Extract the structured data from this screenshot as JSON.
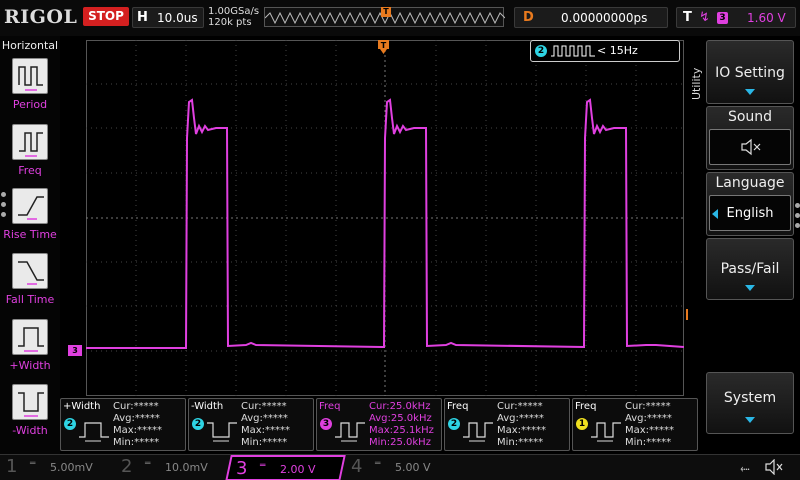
{
  "brand": "RIGOL",
  "run_state": "STOP",
  "horizontal": {
    "label": "H",
    "timebase": "10.0us",
    "sample_rate": "1.00GSa/s",
    "memory_depth": "120k pts"
  },
  "trigger_pos_marker": "T",
  "delay": {
    "label": "D",
    "value": "0.00000000ps"
  },
  "trigger": {
    "label": "T",
    "source_channel": "3",
    "level": "1.60 V"
  },
  "left_menu": {
    "title": "Horizontal",
    "items": [
      {
        "label": "Period",
        "icon": "period-icon"
      },
      {
        "label": "Freq",
        "icon": "frequency-icon"
      },
      {
        "label": "Rise Time",
        "icon": "rise-time-icon"
      },
      {
        "label": "Fall Time",
        "icon": "fall-time-icon"
      },
      {
        "label": "+Width",
        "icon": "positive-width-icon"
      },
      {
        "label": "-Width",
        "icon": "negative-width-icon"
      }
    ]
  },
  "grid": {
    "ch3_marker": "3",
    "trigger_level_marker": "T",
    "ch2_label": {
      "channel": "2",
      "text": "< 15Hz"
    }
  },
  "right_menu": {
    "side_tab": "Utility",
    "io_setting": "IO Setting",
    "sound": {
      "label": "Sound",
      "icon": "speaker-mute-icon"
    },
    "language": {
      "label": "Language",
      "value": "English"
    },
    "pass_fail": "Pass/Fail",
    "system": "System"
  },
  "measurements": [
    {
      "title": "+Width",
      "channel": "2",
      "cur": "Cur:*****",
      "avg": "Avg:*****",
      "max": "Max:*****",
      "min": "Min:*****",
      "color": "#2ed4e4"
    },
    {
      "title": "-Width",
      "channel": "2",
      "cur": "Cur:*****",
      "avg": "Avg:*****",
      "max": "Max:*****",
      "min": "Min:*****",
      "color": "#2ed4e4"
    },
    {
      "title": "Freq",
      "channel": "3",
      "cur": "Cur:25.0kHz",
      "avg": "Avg:25.0kHz",
      "max": "Max:25.1kHz",
      "min": "Min:25.0kHz",
      "color": "#e040e0"
    },
    {
      "title": "Freq",
      "channel": "2",
      "cur": "Cur:*****",
      "avg": "Avg:*****",
      "max": "Max:*****",
      "min": "Min:*****",
      "color": "#2ed4e4"
    },
    {
      "title": "Freq",
      "channel": "1",
      "cur": "Cur:*****",
      "avg": "Avg:*****",
      "max": "Max:*****",
      "min": "Min:*****",
      "color": "#f0e020"
    }
  ],
  "channels": [
    {
      "number": "1",
      "scale": "5.00mV",
      "active": false
    },
    {
      "number": "2",
      "scale": "10.0mV",
      "active": false
    },
    {
      "number": "3",
      "scale": "2.00 V",
      "active": true
    },
    {
      "number": "4",
      "scale": "5.00 V",
      "active": false
    }
  ],
  "colors": {
    "ch1": "#f0e020",
    "ch2": "#2ed4e4",
    "ch3": "#e040e0",
    "trigger": "#e87a1e",
    "stop": "#d42020"
  }
}
